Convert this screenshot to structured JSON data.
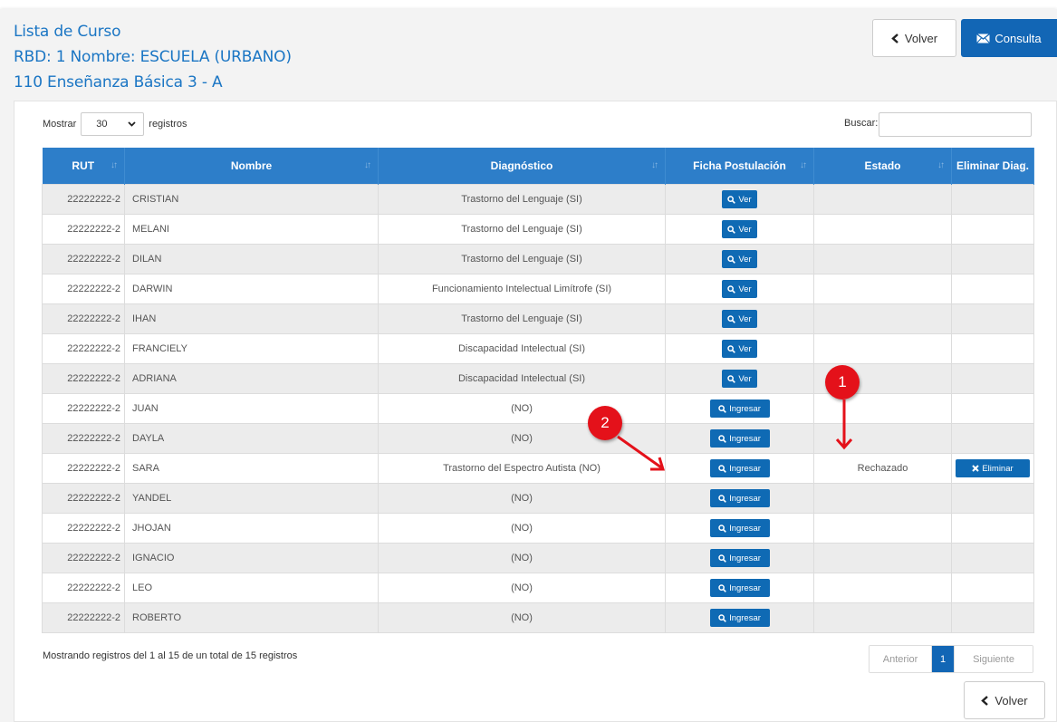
{
  "header": {
    "line1": "Lista de Curso",
    "line2": "RBD: 1   Nombre: ESCUELA (URBANO)",
    "line3": "110 Enseñanza Básica 3 - A",
    "volver_label": "Volver",
    "consulta_label": "Consulta"
  },
  "controls": {
    "mostrar_label": "Mostrar",
    "page_size": "30",
    "registros_label": "registros",
    "buscar_label": "Buscar:",
    "buscar_value": ""
  },
  "table": {
    "columns": [
      "RUT",
      "Nombre",
      "Diagnóstico",
      "Ficha Postulación",
      "Estado",
      "Eliminar Diag."
    ],
    "rows": [
      {
        "rut": "22222222-2",
        "nombre": "CRISTIAN",
        "diag": "Trastorno del Lenguaje (SI)",
        "ficha": "Ver",
        "estado": "",
        "eliminar": ""
      },
      {
        "rut": "22222222-2",
        "nombre": "MELANI",
        "diag": "Trastorno del Lenguaje (SI)",
        "ficha": "Ver",
        "estado": "",
        "eliminar": ""
      },
      {
        "rut": "22222222-2",
        "nombre": "DILAN",
        "diag": "Trastorno del Lenguaje (SI)",
        "ficha": "Ver",
        "estado": "",
        "eliminar": ""
      },
      {
        "rut": "22222222-2",
        "nombre": "DARWIN",
        "diag": "Funcionamiento Intelectual Limítrofe (SI)",
        "ficha": "Ver",
        "estado": "",
        "eliminar": ""
      },
      {
        "rut": "22222222-2",
        "nombre": "IHAN",
        "diag": "Trastorno del Lenguaje (SI)",
        "ficha": "Ver",
        "estado": "",
        "eliminar": ""
      },
      {
        "rut": "22222222-2",
        "nombre": "FRANCIELY",
        "diag": "Discapacidad Intelectual (SI)",
        "ficha": "Ver",
        "estado": "",
        "eliminar": ""
      },
      {
        "rut": "22222222-2",
        "nombre": "ADRIANA",
        "diag": "Discapacidad Intelectual (SI)",
        "ficha": "Ver",
        "estado": "",
        "eliminar": ""
      },
      {
        "rut": "22222222-2",
        "nombre": "JUAN",
        "diag": "(NO)",
        "ficha": "Ingresar",
        "estado": "",
        "eliminar": ""
      },
      {
        "rut": "22222222-2",
        "nombre": "DAYLA",
        "diag": "(NO)",
        "ficha": "Ingresar",
        "estado": "",
        "eliminar": ""
      },
      {
        "rut": "22222222-2",
        "nombre": "SARA",
        "diag": "Trastorno del Espectro Autista (NO)",
        "ficha": "Ingresar",
        "estado": "Rechazado",
        "eliminar": "Eliminar"
      },
      {
        "rut": "22222222-2",
        "nombre": "YANDEL",
        "diag": "(NO)",
        "ficha": "Ingresar",
        "estado": "",
        "eliminar": ""
      },
      {
        "rut": "22222222-2",
        "nombre": "JHOJAN",
        "diag": "(NO)",
        "ficha": "Ingresar",
        "estado": "",
        "eliminar": ""
      },
      {
        "rut": "22222222-2",
        "nombre": "IGNACIO",
        "diag": "(NO)",
        "ficha": "Ingresar",
        "estado": "",
        "eliminar": ""
      },
      {
        "rut": "22222222-2",
        "nombre": "LEO",
        "diag": "(NO)",
        "ficha": "Ingresar",
        "estado": "",
        "eliminar": ""
      },
      {
        "rut": "22222222-2",
        "nombre": "ROBERTO",
        "diag": "(NO)",
        "ficha": "Ingresar",
        "estado": "",
        "eliminar": ""
      }
    ]
  },
  "footer": {
    "info": "Mostrando registros del 1 al 15 de un total de 15 registros",
    "prev_label": "Anterior",
    "current_page": "1",
    "next_label": "Siguiente",
    "volver_label": "Volver"
  },
  "annotations": {
    "marker1": "1",
    "marker2": "2"
  },
  "colors": {
    "header_blue": "#2d7ec9",
    "button_blue": "#0f6ab4",
    "title_blue": "#1b76c4",
    "marker_red": "#e4111a"
  },
  "icons": {
    "volver": "chevron-left-icon",
    "consulta": "envelope-icon",
    "ver": "search-icon",
    "ingresar": "search-icon",
    "eliminar": "close-icon",
    "select": "chevron-down-icon",
    "sort": "sort-icon"
  }
}
